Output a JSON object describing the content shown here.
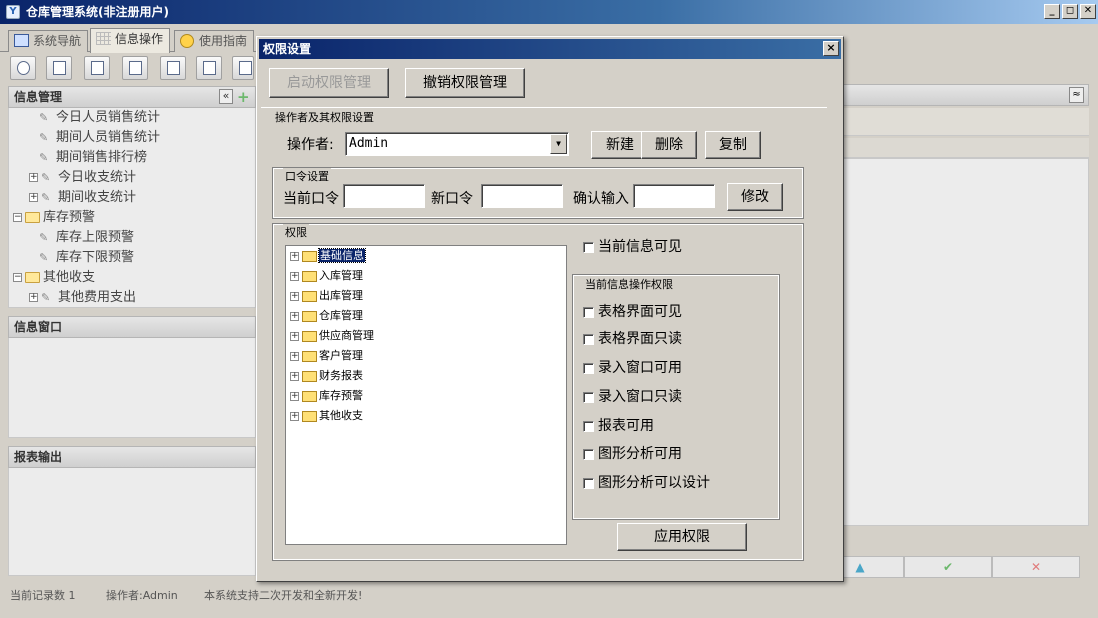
{
  "main_window": {
    "title": "仓库管理系统(非注册用户)",
    "minimize": "_",
    "restore": "◻",
    "close": "✕"
  },
  "tabs": [
    {
      "label": "系统导航",
      "icon": "monitor-icon"
    },
    {
      "label": "信息操作",
      "icon": "grid-icon"
    },
    {
      "label": "使用指南",
      "icon": "guide-icon"
    }
  ],
  "left_panel": {
    "info_header": "信息管理",
    "collapse_icon": "«",
    "add_icon": "+",
    "tree": [
      {
        "label": "今日人员销售统计"
      },
      {
        "label": "期间人员销售统计"
      },
      {
        "label": "期间销售排行榜"
      },
      {
        "label": "今日收支统计"
      },
      {
        "label": "期间收支统计"
      },
      {
        "label": "库存预警"
      },
      {
        "label": "库存上限预警"
      },
      {
        "label": "库存下限预警"
      },
      {
        "label": "其他收支"
      },
      {
        "label": "其他费用支出"
      }
    ],
    "window_header": "信息窗口",
    "report_header": "报表输出"
  },
  "right_panel": {
    "collapse_icon": "≈",
    "buttons": [
      {
        "symbol": "▲",
        "color": "#4aa6c8"
      },
      {
        "symbol": "✔",
        "color": "#6cb86c"
      },
      {
        "symbol": "✕",
        "color": "#e07a7a"
      }
    ]
  },
  "status_bar": {
    "records": "当前记录数 1",
    "operator": "操作者:Admin",
    "message": "本系统支持二次开发和全新开发!"
  },
  "dialog": {
    "title": "权限设置",
    "close": "×",
    "enable_button": "启动权限管理",
    "revoke_button": "撤销权限管理",
    "operator_section": {
      "label": "操作者及其权限设置",
      "operator_label": "操作者:",
      "operator_value": "Admin",
      "new_button": "新建",
      "delete_button": "删除",
      "copy_button": "复制"
    },
    "password_section": {
      "label": "口令设置",
      "current_label": "当前口令",
      "current_value": "",
      "new_label": "新口令",
      "new_value": "",
      "confirm_label": "确认输入",
      "confirm_value": "",
      "modify_button": "修改"
    },
    "permission_section": {
      "label": "权限",
      "tree": [
        {
          "label": "基础信息",
          "selected": true
        },
        {
          "label": "入库管理"
        },
        {
          "label": "出库管理"
        },
        {
          "label": "仓库管理"
        },
        {
          "label": "供应商管理"
        },
        {
          "label": "客户管理"
        },
        {
          "label": "财务报表"
        },
        {
          "label": "库存预警"
        },
        {
          "label": "其他收支"
        }
      ],
      "current_visible": {
        "label": "当前信息可见",
        "checked": false
      },
      "ops_label": "当前信息操作权限",
      "ops": [
        {
          "label": "表格界面可见",
          "checked": false
        },
        {
          "label": "表格界面只读",
          "checked": false
        },
        {
          "label": "录入窗口可用",
          "checked": false
        },
        {
          "label": "录入窗口只读",
          "checked": false
        },
        {
          "label": "报表可用",
          "checked": false
        },
        {
          "label": "图形分析可用",
          "checked": false
        },
        {
          "label": "图形分析可以设计",
          "checked": false
        }
      ],
      "apply_button": "应用权限"
    }
  }
}
